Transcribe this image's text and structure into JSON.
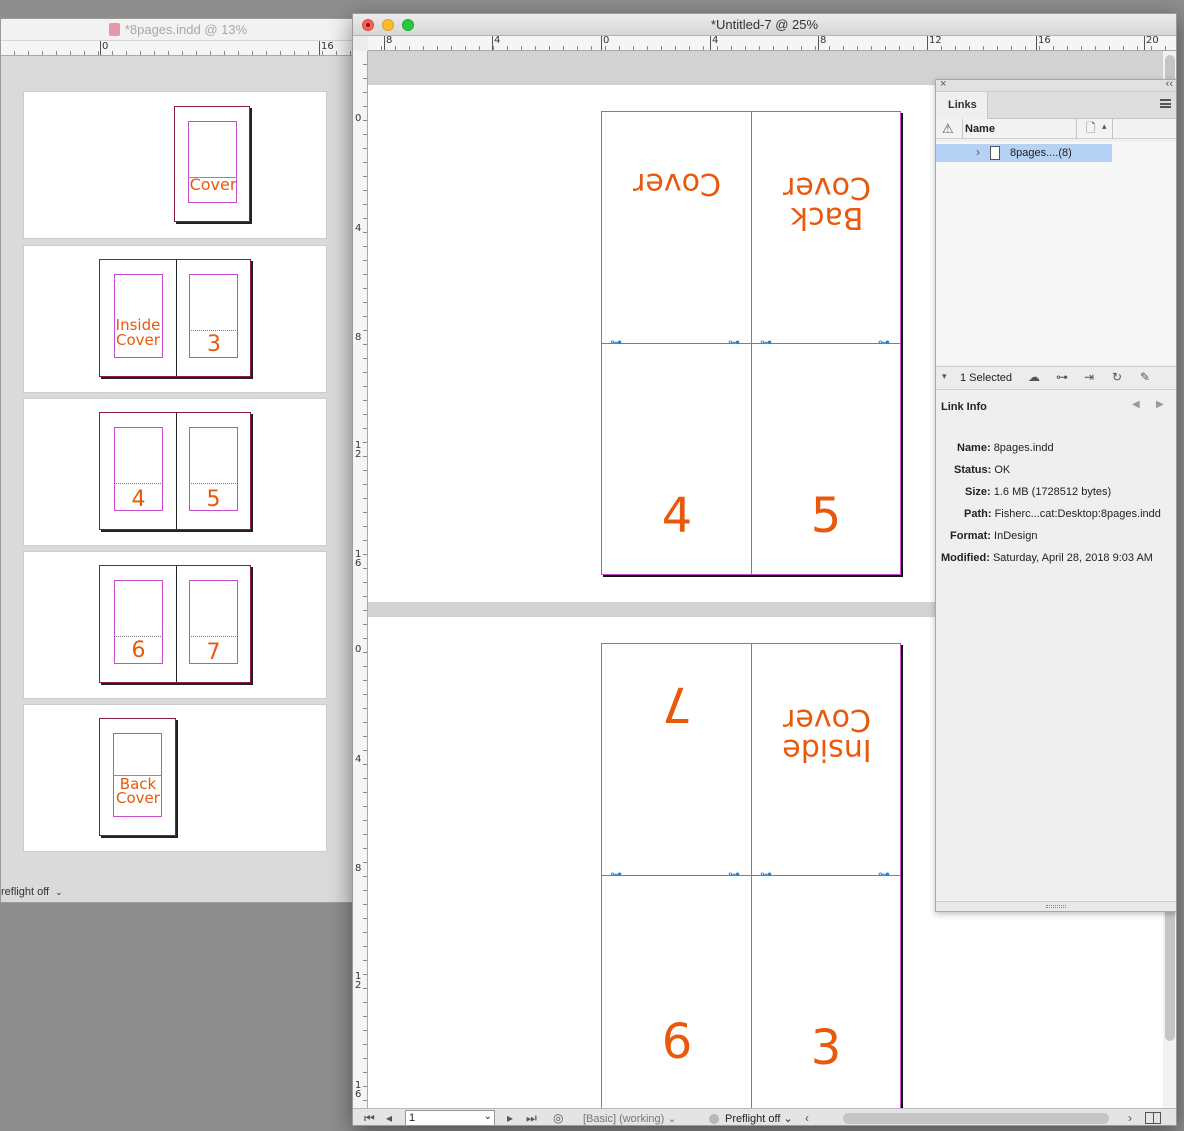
{
  "back_window": {
    "title": "*8pages.indd @ 13%",
    "ruler_labels": [
      "0",
      "16"
    ],
    "pages": {
      "cover": "Cover",
      "inside_cover_1": "Inside",
      "inside_cover_2": "Cover",
      "p3": "3",
      "p4": "4",
      "p5": "5",
      "p6": "6",
      "p7": "7",
      "back_cover_1": "Back",
      "back_cover_2": "Cover"
    },
    "status": "reflight off"
  },
  "front_window": {
    "title": "*Untitled-7 @ 25%",
    "hruler_labels": [
      "8",
      "4",
      "0",
      "4",
      "8",
      "12",
      "16",
      "20"
    ],
    "vruler_labels_top": [
      "0",
      "4",
      "8",
      "1\n2",
      "1\n6"
    ],
    "vruler_labels_bottom": [
      "0",
      "4",
      "8",
      "1\n2",
      "1\n6"
    ],
    "sheet1": {
      "top_left": "Cover",
      "top_right_1": "Back",
      "top_right_2": "Cover",
      "bottom_left": "4",
      "bottom_right": "5"
    },
    "sheet2": {
      "top_left": "7",
      "top_right_1": "Inside",
      "top_right_2": "Cover",
      "bottom_left": "6",
      "bottom_right": "3"
    },
    "statusbar": {
      "page_number": "1",
      "style": "[Basic] (working)",
      "preflight": "Preflight off"
    }
  },
  "links_panel": {
    "tab": "Links",
    "column_name": "Name",
    "link_item": "8pages....(8)",
    "selected_count": "1 Selected",
    "link_info_heading": "Link Info",
    "info": [
      {
        "label": "Name:",
        "value": "8pages.indd"
      },
      {
        "label": "Status:",
        "value": "OK"
      },
      {
        "label": "Size:",
        "value": "1.6 MB (1728512 bytes)"
      },
      {
        "label": "Path:",
        "value": "Fisherc...cat:Desktop:8pages.indd"
      },
      {
        "label": "Format:",
        "value": "InDesign"
      },
      {
        "label": "Modified:",
        "value": "Saturday, April 28, 2018 9:03 AM"
      }
    ]
  },
  "colors": {
    "accent_text": "#e8590c",
    "margin_guide": "#c94bd1",
    "guide_blue": "#3d8ee0",
    "selection": "#b5d1f3"
  }
}
